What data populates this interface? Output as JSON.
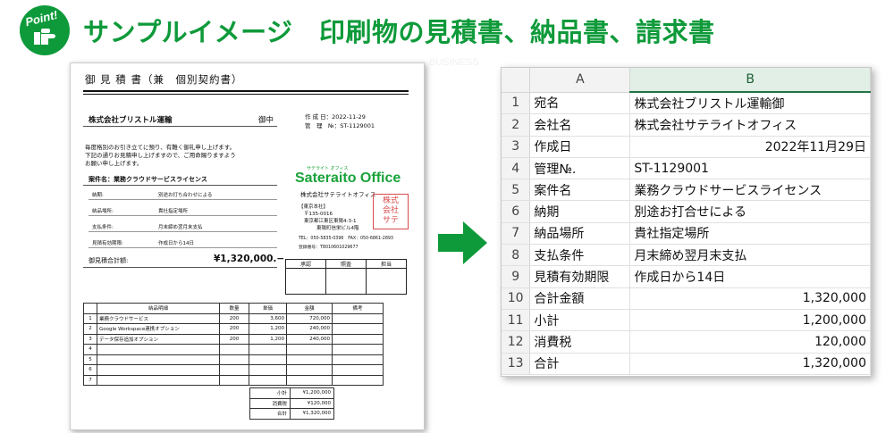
{
  "header": {
    "badge": "Point!",
    "title": "サンプルイメージ　印刷物の見積書、納品書、請求書"
  },
  "background": {
    "word": "BUSINESS"
  },
  "document": {
    "title": "御 見 積 書（兼　個別契約書）",
    "recipient": "株式会社ブリストル運輸",
    "honorific": "御中",
    "created_label": "作 成 日：2022-11-29",
    "mgmt_label": "管　理　№：ST-1129001",
    "greeting": [
      "毎度格別のお引き立てに預り、有難く御礼申し上げます。",
      "下記の通りお見積申し上げますので、ご用命賜りますよう",
      "お願い申し上げます。"
    ],
    "project_label": "案件名：業務クラウドサービスライセンス",
    "fields": [
      {
        "label": "納期:",
        "value": "別途お打ち合わせによる"
      },
      {
        "label": "納品場所:",
        "value": "貴社指定場所"
      },
      {
        "label": "支払条件:",
        "value": "月末締め翌月末支払"
      },
      {
        "label": "見積有効期限:",
        "value": "作成日から14日"
      }
    ],
    "total_label": "御見積合計額:",
    "total_value": "¥1,320,000.−",
    "company": {
      "kana": "サテライト オフィス",
      "logo": "Sateraito Office",
      "name": "株式会社サテライトオフィス",
      "branch": "【東京本社】",
      "zip": "〒135-0016",
      "address1": "東京都江東区東陽4-3-1",
      "address2": "東陽町信栄ビル4階",
      "tel": "TEL：050-5835-0396　FAX：050-6861-2893",
      "reg": "登録番号：T8010601029677"
    },
    "stamp_text": "株式会社サテライトオフィス",
    "approval_headers": [
      "承認",
      "照査",
      "担当"
    ],
    "items_headers": [
      "",
      "納品明細",
      "数量",
      "単価",
      "金額",
      "備考"
    ],
    "items": [
      {
        "no": "1",
        "name": "業務クラウドサービス",
        "qty": "200",
        "price": "3,600",
        "amount": "720,000",
        "note": ""
      },
      {
        "no": "2",
        "name": "Google Workspace連携オプション",
        "qty": "200",
        "price": "1,200",
        "amount": "240,000",
        "note": ""
      },
      {
        "no": "3",
        "name": "データ保存追加オプション",
        "qty": "200",
        "price": "1,200",
        "amount": "240,000",
        "note": ""
      },
      {
        "no": "4",
        "name": "",
        "qty": "",
        "price": "",
        "amount": "",
        "note": ""
      },
      {
        "no": "5",
        "name": "",
        "qty": "",
        "price": "",
        "amount": "",
        "note": ""
      },
      {
        "no": "6",
        "name": "",
        "qty": "",
        "price": "",
        "amount": "",
        "note": ""
      },
      {
        "no": "7",
        "name": "",
        "qty": "",
        "price": "",
        "amount": "",
        "note": ""
      }
    ],
    "summary": [
      {
        "label": "小計",
        "value": "¥1,200,000"
      },
      {
        "label": "消費税",
        "value": "¥120,000"
      },
      {
        "label": "合計",
        "value": "¥1,320,000"
      }
    ]
  },
  "sheet": {
    "columns": [
      "A",
      "B"
    ],
    "rows": [
      {
        "n": "1",
        "a": "宛名",
        "b": "株式会社ブリストル運輸御",
        "align": "l"
      },
      {
        "n": "2",
        "a": "会社名",
        "b": "株式会社サテライトオフィス",
        "align": "l"
      },
      {
        "n": "3",
        "a": "作成日",
        "b": "2022年11月29日",
        "align": "r"
      },
      {
        "n": "4",
        "a": "管理№.",
        "b": "ST-1129001",
        "align": "l"
      },
      {
        "n": "5",
        "a": "案件名",
        "b": "業務クラウドサービスライセンス",
        "align": "l"
      },
      {
        "n": "6",
        "a": "納期",
        "b": "別途お打合せによる",
        "align": "l"
      },
      {
        "n": "7",
        "a": "納品場所",
        "b": "貴社指定場所",
        "align": "l"
      },
      {
        "n": "8",
        "a": "支払条件",
        "b": "月末締め翌月末支払",
        "align": "l"
      },
      {
        "n": "9",
        "a": "見積有効期限",
        "b": "作成日から14日",
        "align": "l"
      },
      {
        "n": "10",
        "a": "合計金額",
        "b": "1,320,000",
        "align": "r"
      },
      {
        "n": "11",
        "a": "小計",
        "b": "1,200,000",
        "align": "r"
      },
      {
        "n": "12",
        "a": "消費税",
        "b": "120,000",
        "align": "r"
      },
      {
        "n": "13",
        "a": "合計",
        "b": "1,320,000",
        "align": "r"
      }
    ]
  },
  "colors": {
    "brand_green": "#0e9a3a",
    "stamp_red": "#d84a4a",
    "excel_green": "#217346"
  }
}
